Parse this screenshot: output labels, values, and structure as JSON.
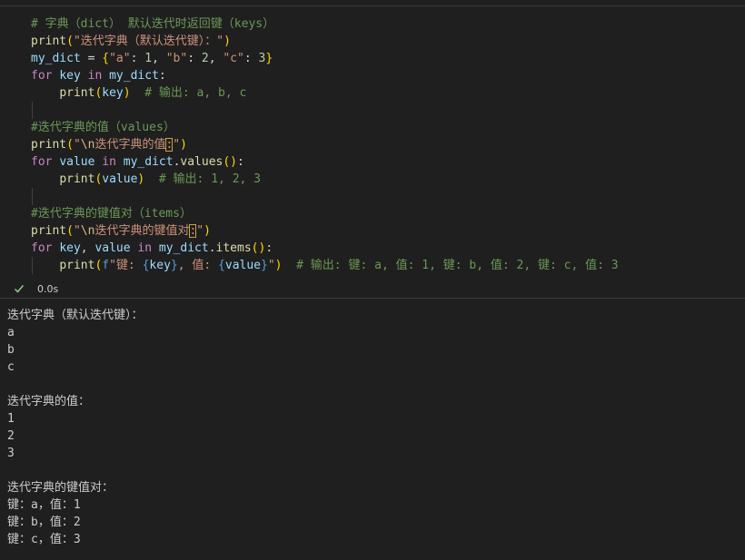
{
  "code": {
    "lines": [
      [
        {
          "t": "# 字典（dict） 默认迭代时返回键（keys）",
          "c": "cm"
        }
      ],
      [
        {
          "t": "print",
          "c": "fn"
        },
        {
          "t": "(",
          "c": "br1"
        },
        {
          "t": "\"迭代字典（默认迭代键）：\"",
          "c": "str"
        },
        {
          "t": ")",
          "c": "br1"
        }
      ],
      [
        {
          "t": "my_dict",
          "c": "var"
        },
        {
          "t": " = ",
          "c": "op"
        },
        {
          "t": "{",
          "c": "br1"
        },
        {
          "t": "\"a\"",
          "c": "str"
        },
        {
          "t": ": ",
          "c": "op"
        },
        {
          "t": "1",
          "c": "num"
        },
        {
          "t": ", ",
          "c": "op"
        },
        {
          "t": "\"b\"",
          "c": "str"
        },
        {
          "t": ": ",
          "c": "op"
        },
        {
          "t": "2",
          "c": "num"
        },
        {
          "t": ", ",
          "c": "op"
        },
        {
          "t": "\"c\"",
          "c": "str"
        },
        {
          "t": ": ",
          "c": "op"
        },
        {
          "t": "3",
          "c": "num"
        },
        {
          "t": "}",
          "c": "br1"
        }
      ],
      [
        {
          "t": "for",
          "c": "kw"
        },
        {
          "t": " ",
          "c": "op"
        },
        {
          "t": "key",
          "c": "var"
        },
        {
          "t": " ",
          "c": "op"
        },
        {
          "t": "in",
          "c": "kw"
        },
        {
          "t": " ",
          "c": "op"
        },
        {
          "t": "my_dict",
          "c": "var"
        },
        {
          "t": ":",
          "c": "op"
        }
      ],
      [
        {
          "t": "    ",
          "c": "op"
        },
        {
          "t": "print",
          "c": "fn"
        },
        {
          "t": "(",
          "c": "br1"
        },
        {
          "t": "key",
          "c": "var"
        },
        {
          "t": ")",
          "c": "br1"
        },
        {
          "t": "  ",
          "c": "op"
        },
        {
          "t": "# 输出: a, b, c",
          "c": "cm"
        }
      ],
      [],
      [
        {
          "t": "#迭代字典的值（values）",
          "c": "cm"
        }
      ],
      [
        {
          "t": "print",
          "c": "fn"
        },
        {
          "t": "(",
          "c": "br1"
        },
        {
          "t": "\"",
          "c": "str"
        },
        {
          "t": "\\n",
          "c": "esc"
        },
        {
          "t": "迭代字典的值",
          "c": "str"
        },
        {
          "t": ":",
          "c": "str",
          "box": true
        },
        {
          "t": "\"",
          "c": "str"
        },
        {
          "t": ")",
          "c": "br1"
        }
      ],
      [
        {
          "t": "for",
          "c": "kw"
        },
        {
          "t": " ",
          "c": "op"
        },
        {
          "t": "value",
          "c": "var"
        },
        {
          "t": " ",
          "c": "op"
        },
        {
          "t": "in",
          "c": "kw"
        },
        {
          "t": " ",
          "c": "op"
        },
        {
          "t": "my_dict",
          "c": "var"
        },
        {
          "t": ".",
          "c": "op"
        },
        {
          "t": "values",
          "c": "fn"
        },
        {
          "t": "()",
          "c": "br1"
        },
        {
          "t": ":",
          "c": "op"
        }
      ],
      [
        {
          "t": "    ",
          "c": "op"
        },
        {
          "t": "print",
          "c": "fn"
        },
        {
          "t": "(",
          "c": "br1"
        },
        {
          "t": "value",
          "c": "var"
        },
        {
          "t": ")",
          "c": "br1"
        },
        {
          "t": "  ",
          "c": "op"
        },
        {
          "t": "# 输出: 1, 2, 3",
          "c": "cm"
        }
      ],
      [],
      [
        {
          "t": "#迭代字典的键值对（items）",
          "c": "cm"
        }
      ],
      [
        {
          "t": "print",
          "c": "fn"
        },
        {
          "t": "(",
          "c": "br1"
        },
        {
          "t": "\"",
          "c": "str"
        },
        {
          "t": "\\n",
          "c": "esc"
        },
        {
          "t": "迭代字典的键值对",
          "c": "str"
        },
        {
          "t": ":",
          "c": "str",
          "box": true
        },
        {
          "t": "\"",
          "c": "str"
        },
        {
          "t": ")",
          "c": "br1"
        }
      ],
      [
        {
          "t": "for",
          "c": "kw"
        },
        {
          "t": " ",
          "c": "op"
        },
        {
          "t": "key",
          "c": "var"
        },
        {
          "t": ", ",
          "c": "op"
        },
        {
          "t": "value",
          "c": "var"
        },
        {
          "t": " ",
          "c": "op"
        },
        {
          "t": "in",
          "c": "kw"
        },
        {
          "t": " ",
          "c": "op"
        },
        {
          "t": "my_dict",
          "c": "var"
        },
        {
          "t": ".",
          "c": "op"
        },
        {
          "t": "items",
          "c": "fn"
        },
        {
          "t": "()",
          "c": "br1"
        },
        {
          "t": ":",
          "c": "op"
        }
      ],
      [
        {
          "t": "    ",
          "c": "op"
        },
        {
          "t": "print",
          "c": "fn"
        },
        {
          "t": "(",
          "c": "br1"
        },
        {
          "t": "f",
          "c": "fmt"
        },
        {
          "t": "\"键: ",
          "c": "str"
        },
        {
          "t": "{",
          "c": "fmt"
        },
        {
          "t": "key",
          "c": "var"
        },
        {
          "t": "}",
          "c": "fmt"
        },
        {
          "t": ", 值: ",
          "c": "str"
        },
        {
          "t": "{",
          "c": "fmt"
        },
        {
          "t": "value",
          "c": "var"
        },
        {
          "t": "}",
          "c": "fmt"
        },
        {
          "t": "\"",
          "c": "str"
        },
        {
          "t": ")",
          "c": "br1"
        },
        {
          "t": "  ",
          "c": "op"
        },
        {
          "t": "# 输出: 键: a, 值: 1, 键: b, 值: 2, 键: c, 值: 3",
          "c": "cm"
        }
      ]
    ]
  },
  "status": {
    "icon": "check-icon",
    "time": "0.0s",
    "check_color": "#89d185"
  },
  "output": {
    "lines": [
      "迭代字典（默认迭代键）：",
      "a",
      "b",
      "c",
      "",
      "迭代字典的值：",
      "1",
      "2",
      "3",
      "",
      "迭代字典的键值对：",
      "键：a，值：1",
      "键：b，值：2",
      "键：c，值：3"
    ]
  }
}
